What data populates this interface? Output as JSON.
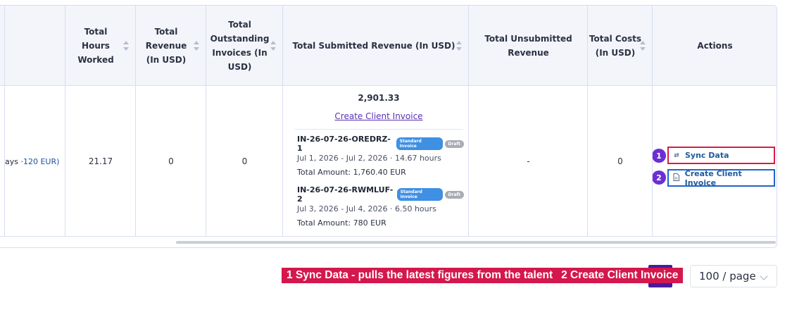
{
  "table": {
    "columns": [
      {
        "label": "Total Hours Worked",
        "sortable": true
      },
      {
        "label": "Total Revenue (In USD)",
        "sortable": true
      },
      {
        "label": "Total Outstanding Invoices (In USD)",
        "sortable": true
      },
      {
        "label": "Total Submitted Revenue (In USD)",
        "sortable": true
      },
      {
        "label": "Total Unsubmitted Revenue",
        "sortable": false
      },
      {
        "label": "Total Costs (In USD)",
        "sortable": true
      },
      {
        "label": "Actions",
        "sortable": false
      }
    ],
    "header_lines": {
      "hours": [
        "Total",
        "Hours",
        "Worked"
      ],
      "revenue": [
        "Total",
        "Revenue",
        "(In USD)"
      ],
      "outstanding": [
        "Total",
        "Outstanding",
        "Invoices (In",
        "USD)"
      ],
      "submitted": [
        "Total Submitted Revenue (In USD)"
      ],
      "unsubmitted": [
        "Total Unsubmitted",
        "Revenue"
      ],
      "costs": [
        "Total Costs",
        "(In USD)"
      ],
      "actions": [
        "Actions"
      ]
    },
    "row": {
      "truncated_prefix": "ays · ",
      "truncated_amount": "120 EUR",
      "truncated_suffix": ")",
      "hours_worked": "21.17",
      "total_revenue": "0",
      "outstanding_invoices": "0",
      "submitted_revenue": "2,901.33",
      "create_invoice_link": "Create Client Invoice",
      "invoices": [
        {
          "id": "IN-26-07-26-OREDRZ-1",
          "type_badge": "Standard Invoice",
          "status_badge": "Draft",
          "period": "Jul 1, 2026 - Jul 2, 2026 · 14.67 hours",
          "total": "Total Amount: 1,760.40 EUR"
        },
        {
          "id": "IN-26-07-26-RWMLUF-2",
          "type_badge": "Standard Invoice",
          "status_badge": "Draft",
          "period": "Jul 3, 2026 - Jul 4, 2026 · 6.50 hours",
          "total": "Total Amount: 780 EUR"
        }
      ],
      "unsubmitted_revenue": "-",
      "total_costs": "0",
      "actions": [
        {
          "number": "1",
          "label": "Sync Data",
          "icon": "sync-icon"
        },
        {
          "number": "2",
          "label": "Create Client Invoice",
          "icon": "document-icon"
        }
      ]
    }
  },
  "footer": {
    "annotation_1": "1 Sync Data - pulls the latest figures from the talent",
    "annotation_2": "2 Create Client Invoice",
    "page_size": "100 / page"
  },
  "colors": {
    "header_bg": "#f3f5fb",
    "border": "#d8def0",
    "link_purple": "#5b2fb5",
    "action_blue": "#1d5b9e",
    "highlight_red": "#d81b4a",
    "highlight_blue": "#2363c8",
    "badge_violet": "#6c2fd2",
    "banner_red": "#d4174c",
    "standard_badge": "#3f8fe3",
    "draft_badge": "#a9acb3"
  }
}
